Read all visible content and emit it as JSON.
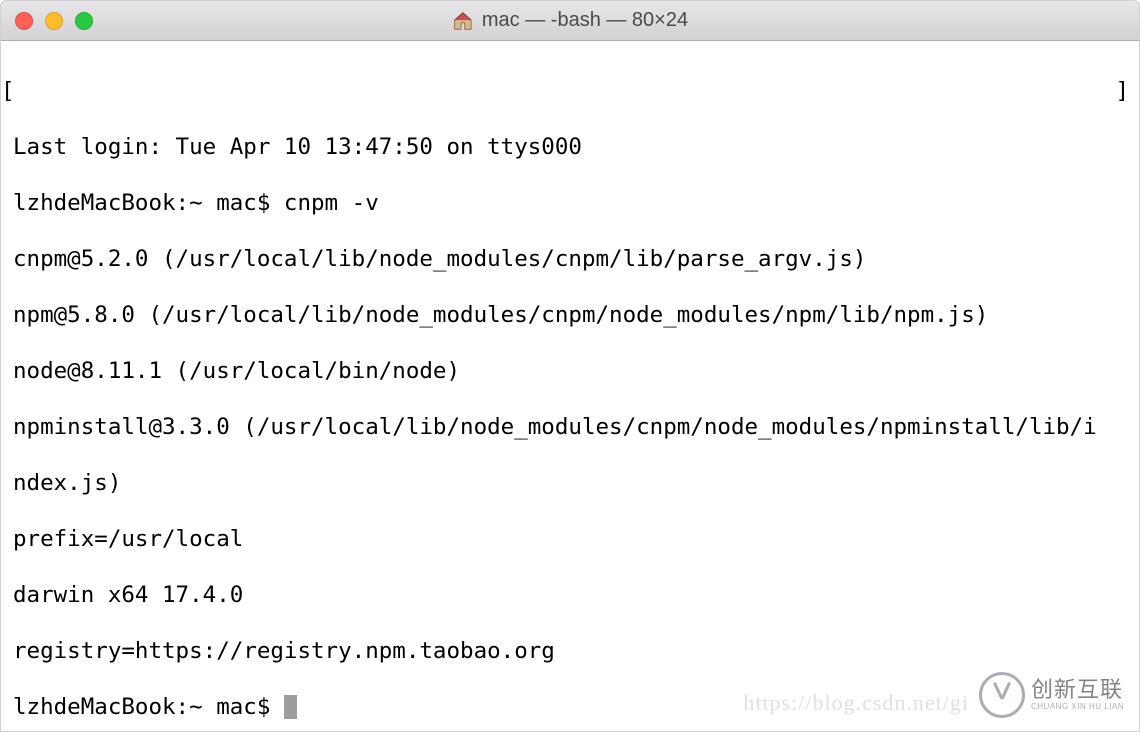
{
  "window": {
    "title": "mac — -bash — 80×24"
  },
  "terminal": {
    "lines": [
      "Last login: Tue Apr 10 13:47:50 on ttys000",
      "lzhdeMacBook:~ mac$ cnpm -v",
      "cnpm@5.2.0 (/usr/local/lib/node_modules/cnpm/lib/parse_argv.js)",
      "npm@5.8.0 (/usr/local/lib/node_modules/cnpm/node_modules/npm/lib/npm.js)",
      "node@8.11.1 (/usr/local/bin/node)",
      "npminstall@3.3.0 (/usr/local/lib/node_modules/cnpm/node_modules/npminstall/lib/i",
      "ndex.js)",
      "prefix=/usr/local",
      "darwin x64 17.4.0",
      "registry=https://registry.npm.taobao.org"
    ],
    "prompt": "lzhdeMacBook:~ mac$ ",
    "left_bracket": "[",
    "right_bracket": "]"
  },
  "watermark": {
    "url": "https://blog.csdn.net/gi",
    "logo_cn": "创新互联",
    "logo_en": "CHUANG XIN HU LIAN"
  }
}
